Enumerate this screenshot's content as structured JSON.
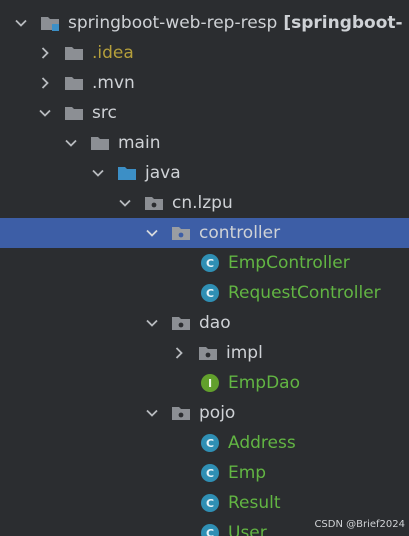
{
  "colors": {
    "background": "#2b2d30",
    "selected_row": "#3d5ea6",
    "text": "#cfd2d6",
    "idea_folder_text": "#b59f3b",
    "class_text": "#62b543",
    "folder_icon": "#8c8f94",
    "source_folder_icon": "#3c8fc6",
    "class_badge": "#2f8fb4",
    "interface_badge": "#62a02c"
  },
  "tree": {
    "root": {
      "name": "springboot-web-rep-resp",
      "module": "[springboot-",
      "icon": "module-folder-icon"
    },
    "idea": {
      "name": ".idea",
      "icon": "folder-icon"
    },
    "mvn": {
      "name": ".mvn",
      "icon": "folder-icon"
    },
    "src": {
      "name": "src",
      "icon": "folder-icon"
    },
    "main": {
      "name": "main",
      "icon": "folder-icon"
    },
    "java": {
      "name": "java",
      "icon": "source-folder-icon"
    },
    "package_root": {
      "name": "cn.lzpu",
      "icon": "package-icon"
    },
    "controller": {
      "name": "controller",
      "icon": "package-icon"
    },
    "emp_controller": {
      "name": "EmpController",
      "badge": "C"
    },
    "request_controller": {
      "name": "RequestController",
      "badge": "C"
    },
    "dao": {
      "name": "dao",
      "icon": "package-icon"
    },
    "impl": {
      "name": "impl",
      "icon": "package-icon"
    },
    "emp_dao": {
      "name": "EmpDao",
      "badge": "I"
    },
    "pojo": {
      "name": "pojo",
      "icon": "package-icon"
    },
    "address": {
      "name": "Address",
      "badge": "C"
    },
    "emp": {
      "name": "Emp",
      "badge": "C"
    },
    "result": {
      "name": "Result",
      "badge": "C"
    },
    "user": {
      "name": "User",
      "badge": "C"
    }
  },
  "watermark": "CSDN @Brief2024"
}
